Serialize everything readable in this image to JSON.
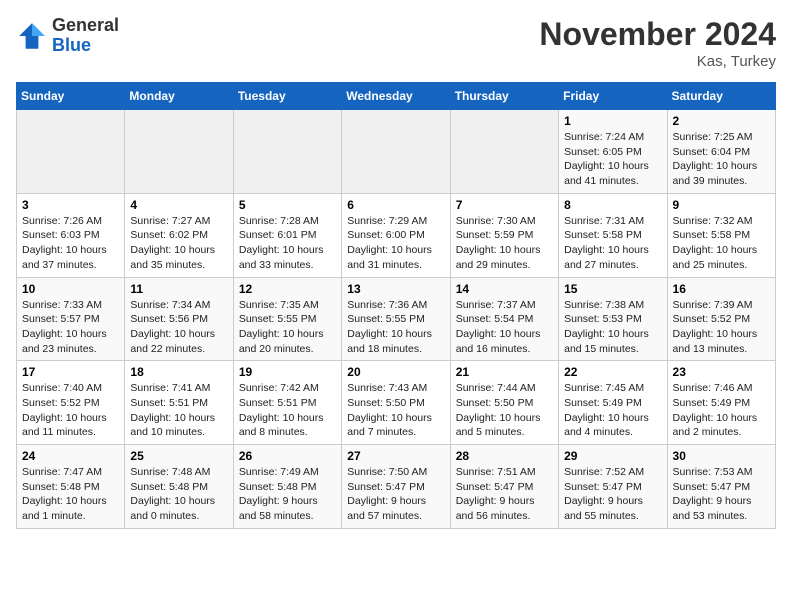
{
  "header": {
    "logo_line1": "General",
    "logo_line2": "Blue",
    "month": "November 2024",
    "location": "Kas, Turkey"
  },
  "weekdays": [
    "Sunday",
    "Monday",
    "Tuesday",
    "Wednesday",
    "Thursday",
    "Friday",
    "Saturday"
  ],
  "weeks": [
    [
      {
        "day": "",
        "info": ""
      },
      {
        "day": "",
        "info": ""
      },
      {
        "day": "",
        "info": ""
      },
      {
        "day": "",
        "info": ""
      },
      {
        "day": "",
        "info": ""
      },
      {
        "day": "1",
        "info": "Sunrise: 7:24 AM\nSunset: 6:05 PM\nDaylight: 10 hours and 41 minutes."
      },
      {
        "day": "2",
        "info": "Sunrise: 7:25 AM\nSunset: 6:04 PM\nDaylight: 10 hours and 39 minutes."
      }
    ],
    [
      {
        "day": "3",
        "info": "Sunrise: 7:26 AM\nSunset: 6:03 PM\nDaylight: 10 hours and 37 minutes."
      },
      {
        "day": "4",
        "info": "Sunrise: 7:27 AM\nSunset: 6:02 PM\nDaylight: 10 hours and 35 minutes."
      },
      {
        "day": "5",
        "info": "Sunrise: 7:28 AM\nSunset: 6:01 PM\nDaylight: 10 hours and 33 minutes."
      },
      {
        "day": "6",
        "info": "Sunrise: 7:29 AM\nSunset: 6:00 PM\nDaylight: 10 hours and 31 minutes."
      },
      {
        "day": "7",
        "info": "Sunrise: 7:30 AM\nSunset: 5:59 PM\nDaylight: 10 hours and 29 minutes."
      },
      {
        "day": "8",
        "info": "Sunrise: 7:31 AM\nSunset: 5:58 PM\nDaylight: 10 hours and 27 minutes."
      },
      {
        "day": "9",
        "info": "Sunrise: 7:32 AM\nSunset: 5:58 PM\nDaylight: 10 hours and 25 minutes."
      }
    ],
    [
      {
        "day": "10",
        "info": "Sunrise: 7:33 AM\nSunset: 5:57 PM\nDaylight: 10 hours and 23 minutes."
      },
      {
        "day": "11",
        "info": "Sunrise: 7:34 AM\nSunset: 5:56 PM\nDaylight: 10 hours and 22 minutes."
      },
      {
        "day": "12",
        "info": "Sunrise: 7:35 AM\nSunset: 5:55 PM\nDaylight: 10 hours and 20 minutes."
      },
      {
        "day": "13",
        "info": "Sunrise: 7:36 AM\nSunset: 5:55 PM\nDaylight: 10 hours and 18 minutes."
      },
      {
        "day": "14",
        "info": "Sunrise: 7:37 AM\nSunset: 5:54 PM\nDaylight: 10 hours and 16 minutes."
      },
      {
        "day": "15",
        "info": "Sunrise: 7:38 AM\nSunset: 5:53 PM\nDaylight: 10 hours and 15 minutes."
      },
      {
        "day": "16",
        "info": "Sunrise: 7:39 AM\nSunset: 5:52 PM\nDaylight: 10 hours and 13 minutes."
      }
    ],
    [
      {
        "day": "17",
        "info": "Sunrise: 7:40 AM\nSunset: 5:52 PM\nDaylight: 10 hours and 11 minutes."
      },
      {
        "day": "18",
        "info": "Sunrise: 7:41 AM\nSunset: 5:51 PM\nDaylight: 10 hours and 10 minutes."
      },
      {
        "day": "19",
        "info": "Sunrise: 7:42 AM\nSunset: 5:51 PM\nDaylight: 10 hours and 8 minutes."
      },
      {
        "day": "20",
        "info": "Sunrise: 7:43 AM\nSunset: 5:50 PM\nDaylight: 10 hours and 7 minutes."
      },
      {
        "day": "21",
        "info": "Sunrise: 7:44 AM\nSunset: 5:50 PM\nDaylight: 10 hours and 5 minutes."
      },
      {
        "day": "22",
        "info": "Sunrise: 7:45 AM\nSunset: 5:49 PM\nDaylight: 10 hours and 4 minutes."
      },
      {
        "day": "23",
        "info": "Sunrise: 7:46 AM\nSunset: 5:49 PM\nDaylight: 10 hours and 2 minutes."
      }
    ],
    [
      {
        "day": "24",
        "info": "Sunrise: 7:47 AM\nSunset: 5:48 PM\nDaylight: 10 hours and 1 minute."
      },
      {
        "day": "25",
        "info": "Sunrise: 7:48 AM\nSunset: 5:48 PM\nDaylight: 10 hours and 0 minutes."
      },
      {
        "day": "26",
        "info": "Sunrise: 7:49 AM\nSunset: 5:48 PM\nDaylight: 9 hours and 58 minutes."
      },
      {
        "day": "27",
        "info": "Sunrise: 7:50 AM\nSunset: 5:47 PM\nDaylight: 9 hours and 57 minutes."
      },
      {
        "day": "28",
        "info": "Sunrise: 7:51 AM\nSunset: 5:47 PM\nDaylight: 9 hours and 56 minutes."
      },
      {
        "day": "29",
        "info": "Sunrise: 7:52 AM\nSunset: 5:47 PM\nDaylight: 9 hours and 55 minutes."
      },
      {
        "day": "30",
        "info": "Sunrise: 7:53 AM\nSunset: 5:47 PM\nDaylight: 9 hours and 53 minutes."
      }
    ]
  ]
}
